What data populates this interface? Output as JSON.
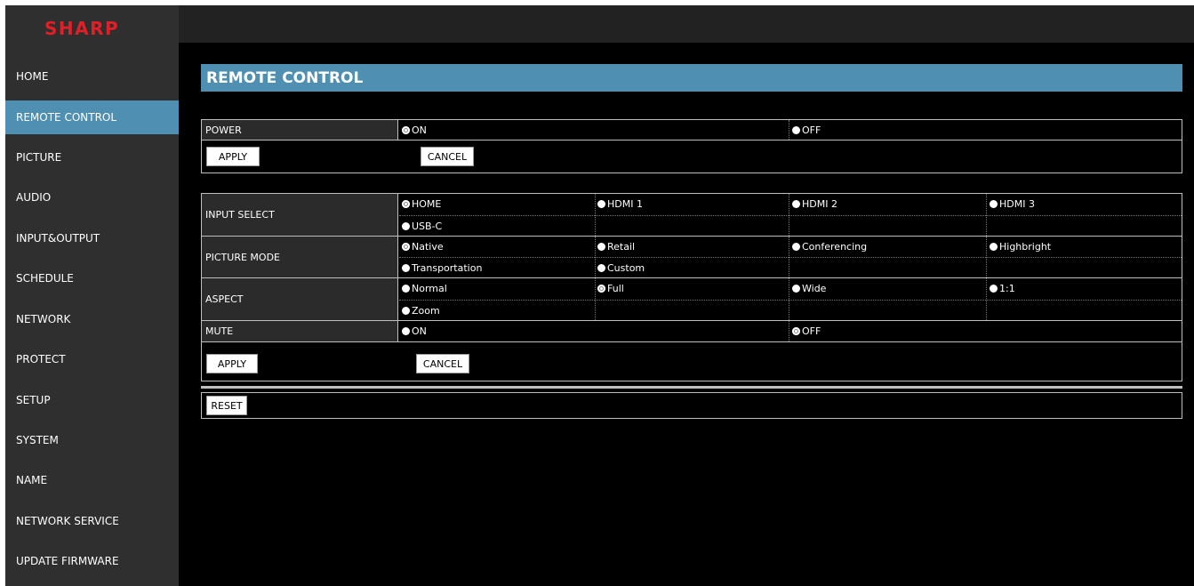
{
  "brand": {
    "logo_text": "SHARP",
    "color": "#e11f26",
    "accent": "#4e8fb2"
  },
  "sidebar": {
    "items": [
      {
        "label": "HOME"
      },
      {
        "label": "REMOTE CONTROL",
        "active": true
      },
      {
        "label": "PICTURE"
      },
      {
        "label": "AUDIO"
      },
      {
        "label": "INPUT&OUTPUT"
      },
      {
        "label": "SCHEDULE"
      },
      {
        "label": "NETWORK"
      },
      {
        "label": "PROTECT"
      },
      {
        "label": "SETUP"
      },
      {
        "label": "SYSTEM"
      },
      {
        "label": "NAME"
      },
      {
        "label": "NETWORK SERVICE"
      },
      {
        "label": "UPDATE FIRMWARE"
      }
    ]
  },
  "page": {
    "title": "REMOTE CONTROL"
  },
  "power": {
    "label": "POWER",
    "options": [
      {
        "label": "ON",
        "selected": true
      },
      {
        "label": "OFF",
        "selected": false
      }
    ],
    "apply": "APPLY",
    "cancel": "CANCEL"
  },
  "settings": {
    "input_select": {
      "label": "INPUT SELECT",
      "options": [
        {
          "label": "HOME",
          "selected": true
        },
        {
          "label": "HDMI 1"
        },
        {
          "label": "HDMI 2"
        },
        {
          "label": "HDMI 3"
        },
        {
          "label": "USB-C"
        }
      ]
    },
    "picture_mode": {
      "label": "PICTURE MODE",
      "options": [
        {
          "label": "Native",
          "selected": true
        },
        {
          "label": "Retail"
        },
        {
          "label": "Conferencing"
        },
        {
          "label": "Highbright"
        },
        {
          "label": "Transportation"
        },
        {
          "label": "Custom"
        }
      ]
    },
    "aspect": {
      "label": "ASPECT",
      "options": [
        {
          "label": "Normal"
        },
        {
          "label": "Full",
          "selected": true
        },
        {
          "label": "Wide"
        },
        {
          "label": "1:1"
        },
        {
          "label": "Zoom"
        }
      ]
    },
    "mute": {
      "label": "MUTE",
      "options": [
        {
          "label": "ON"
        },
        {
          "label": "OFF",
          "selected": true
        }
      ]
    },
    "apply": "APPLY",
    "cancel": "CANCEL"
  },
  "reset": {
    "label": "RESET"
  }
}
